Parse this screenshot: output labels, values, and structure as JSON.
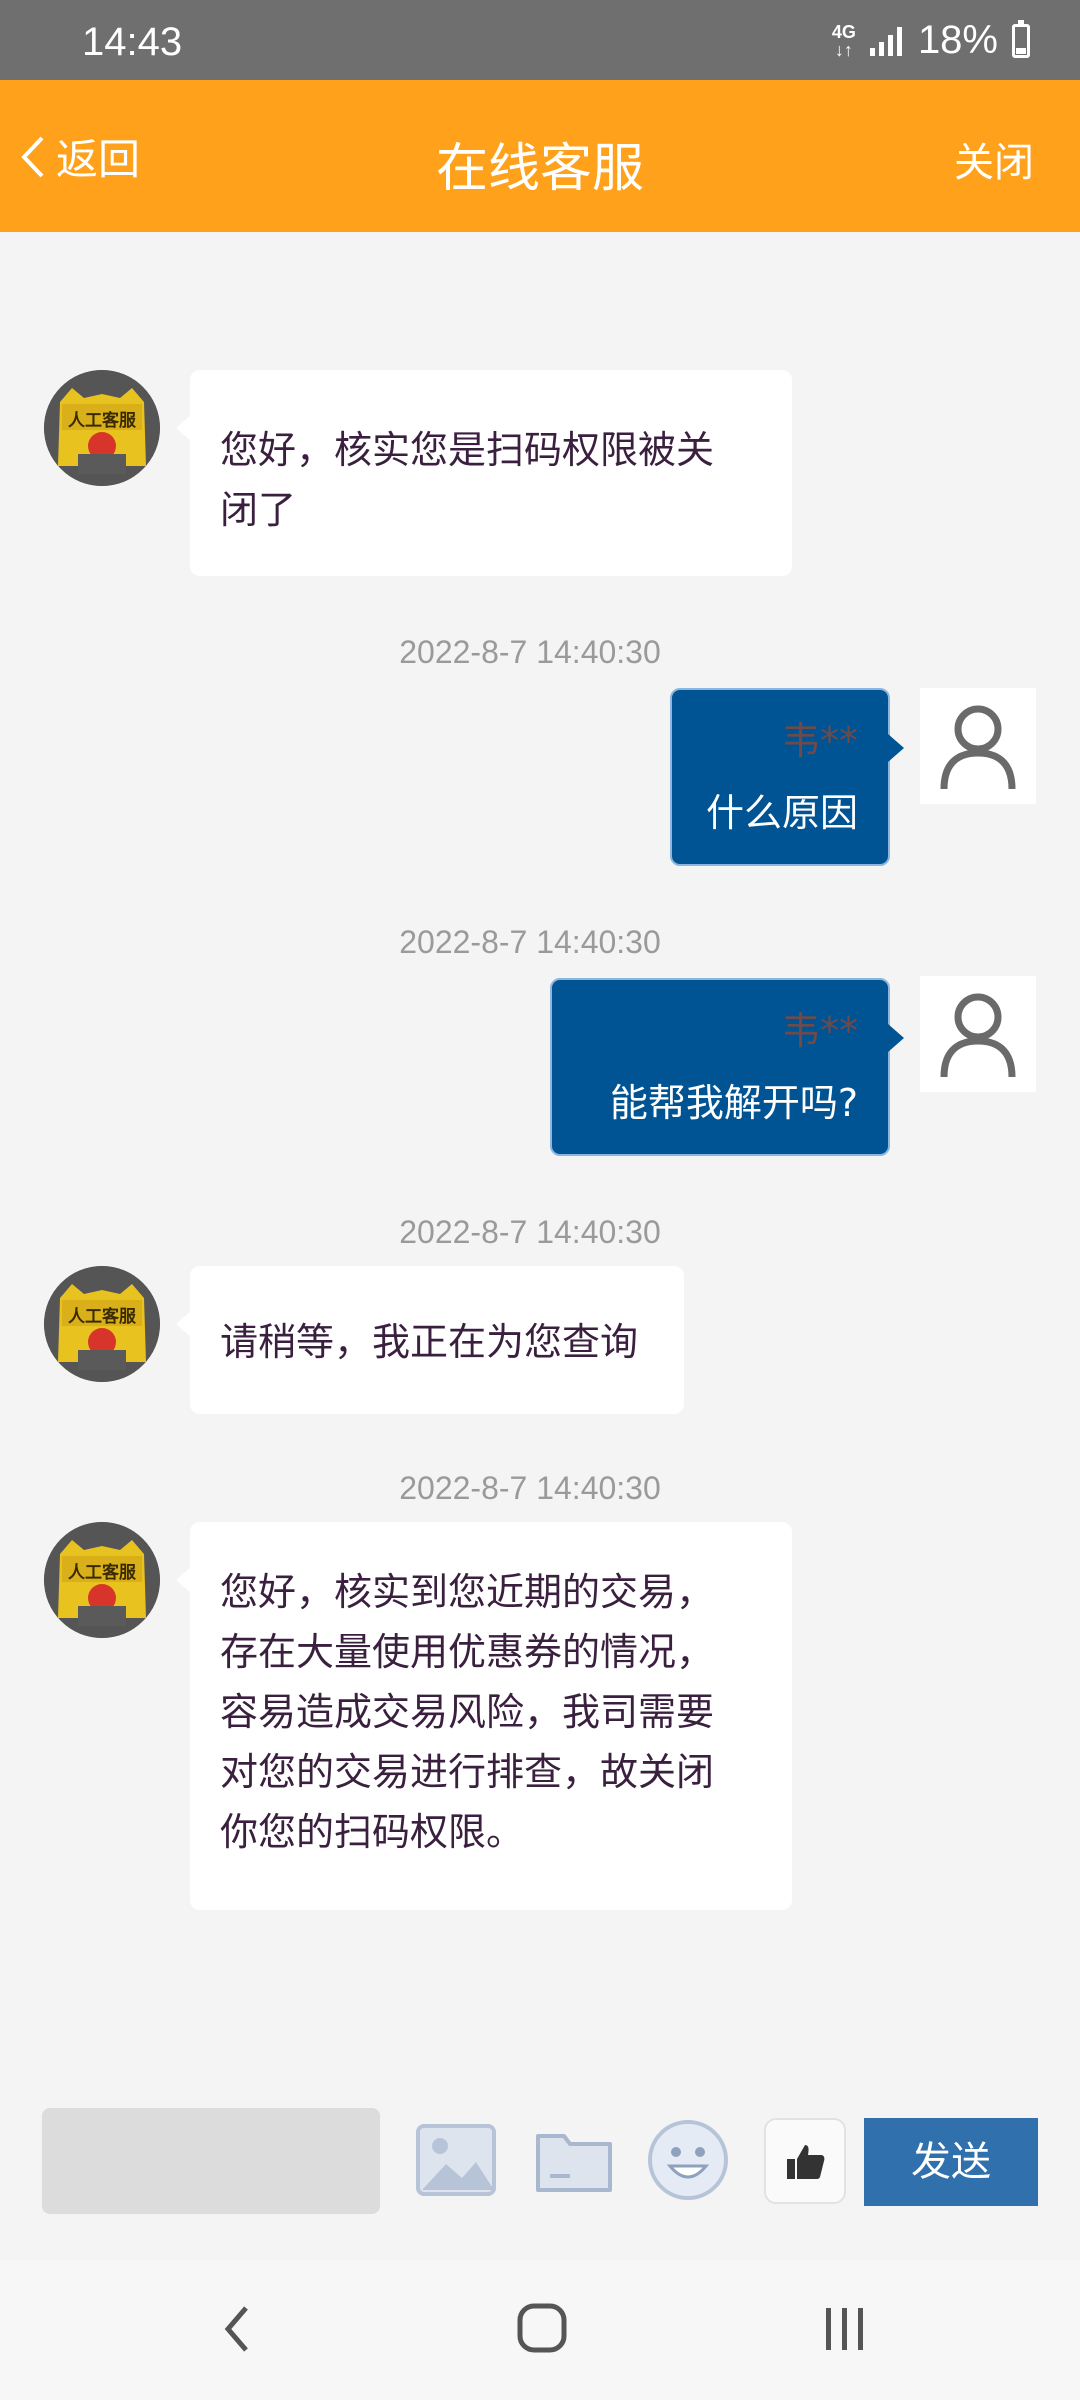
{
  "status_bar": {
    "time": "14:43",
    "network": "4G",
    "battery": "18%"
  },
  "header": {
    "back_label": "返回",
    "title": "在线客服",
    "close_label": "关闭"
  },
  "agent_avatar_text": "人工客服",
  "messages": [
    {
      "from": "agent",
      "lines": [
        "您好，核实您是扫码权限被关",
        "闭了"
      ]
    },
    {
      "timestamp": "2022-8-7 14:40:30",
      "from": "user",
      "sender": "韦**",
      "text": "什么原因"
    },
    {
      "timestamp": "2022-8-7 14:40:30",
      "from": "user",
      "sender": "韦**",
      "text": "能帮我解开吗?"
    },
    {
      "timestamp": "2022-8-7 14:40:30",
      "from": "agent",
      "lines": [
        "请稍等，我正在为您查询"
      ]
    },
    {
      "timestamp": "2022-8-7 14:40:30",
      "from": "agent",
      "lines": [
        "您好，核实到您近期的交易，",
        "存在大量使用优惠券的情况，",
        "容易造成交易风险，我司需要",
        "对您的交易进行排查，故关闭",
        "你您的扫码权限。"
      ]
    }
  ],
  "composer": {
    "input_value": "",
    "send_label": "发送",
    "tools": [
      "image-icon",
      "folder-icon",
      "emoji-icon",
      "thumbs-up-icon"
    ]
  },
  "colors": {
    "header": "#ffa11b",
    "user_bubble": "#005493",
    "send_button": "#2f70ad"
  }
}
